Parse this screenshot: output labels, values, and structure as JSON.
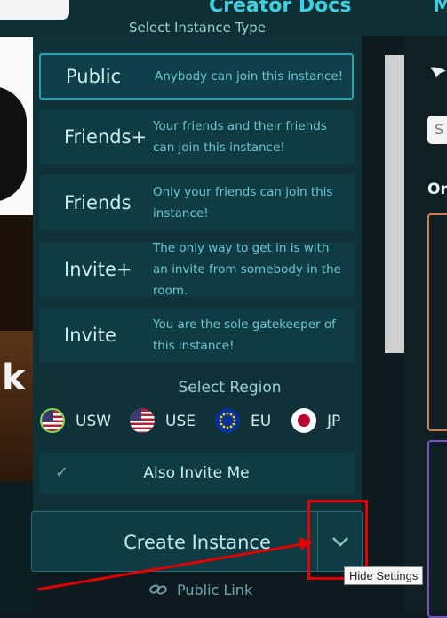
{
  "topbar": {
    "title": "Creator Docs",
    "next_label": "M"
  },
  "panel": {
    "header": "Select Instance Type",
    "instance_types": [
      {
        "name": "Public",
        "desc": "Anybody can join this instance!",
        "selected": true
      },
      {
        "name": "Friends+",
        "desc": "Your friends and their friends can join this instance!"
      },
      {
        "name": "Friends",
        "desc": "Only your friends can join this instance!"
      },
      {
        "name": "Invite+",
        "desc": "The only way to get in is with an invite from somebody in the room."
      },
      {
        "name": "Invite",
        "desc": "You are the sole gatekeeper of this instance!"
      }
    ],
    "region_title": "Select Region",
    "regions": [
      {
        "code": "USW",
        "flag": "us-flag-icon",
        "selected": true
      },
      {
        "code": "USE",
        "flag": "us-flag-icon"
      },
      {
        "code": "EU",
        "flag": "eu-flag-icon"
      },
      {
        "code": "JP",
        "flag": "jp-flag-icon"
      }
    ],
    "also_invite_label": "Also Invite Me",
    "create_label": "Create Instance",
    "public_link_label": "Public Link"
  },
  "tooltip": "Hide Settings",
  "right": {
    "search_letter": "S",
    "section_prefix": "On"
  },
  "left": {
    "partial_text": "k"
  },
  "colors": {
    "accent": "#2aa0b0",
    "panel": "#113138",
    "annotation": "#e00000"
  }
}
